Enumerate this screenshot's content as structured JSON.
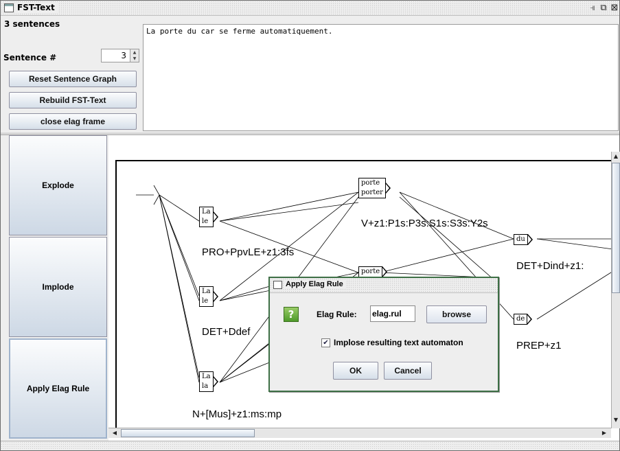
{
  "window": {
    "title": "FST-Text",
    "controls": {
      "minimize": "⫣",
      "maximize": "⧉",
      "close": "⊠"
    }
  },
  "left_panel": {
    "sentence_count": "3 sentences",
    "sentence_label": "Sentence #",
    "sentence_value": "3",
    "buttons": {
      "reset": "Reset Sentence Graph",
      "rebuild": "Rebuild FST-Text",
      "close_elag": "close elag frame"
    }
  },
  "sentence_text": "La porte du car se ferme automatiquement.",
  "side_buttons": {
    "explode": "Explode",
    "implode": "Implode",
    "apply_elag": "Apply Elag Rule"
  },
  "graph": {
    "boxes": [
      {
        "lines": [
          "La",
          "le"
        ]
      },
      {
        "lines": [
          "La",
          "le"
        ]
      },
      {
        "lines": [
          "La",
          "la"
        ]
      },
      {
        "lines": [
          "porte",
          "porter"
        ]
      },
      {
        "lines": [
          "porte"
        ]
      },
      {
        "lines": [
          "du"
        ]
      },
      {
        "lines": [
          "de"
        ]
      }
    ],
    "tags": [
      "V+z1:P1s:P3s:S1s:S3s:Y2s",
      "PRO+PpvLE+z1:3fs",
      "DET+Dind+z1:",
      "DET+Ddef",
      "PREP+z1",
      "N+[Mus]+z1:ms:mp"
    ]
  },
  "dialog": {
    "title": "Apply Elag Rule",
    "icon": "question-icon",
    "rule_label": "Elag Rule:",
    "rule_value": "elag.rul",
    "browse": "browse",
    "checkbox_label": "Implose resulting text automaton",
    "checkbox_checked": true,
    "ok": "OK",
    "cancel": "Cancel"
  }
}
